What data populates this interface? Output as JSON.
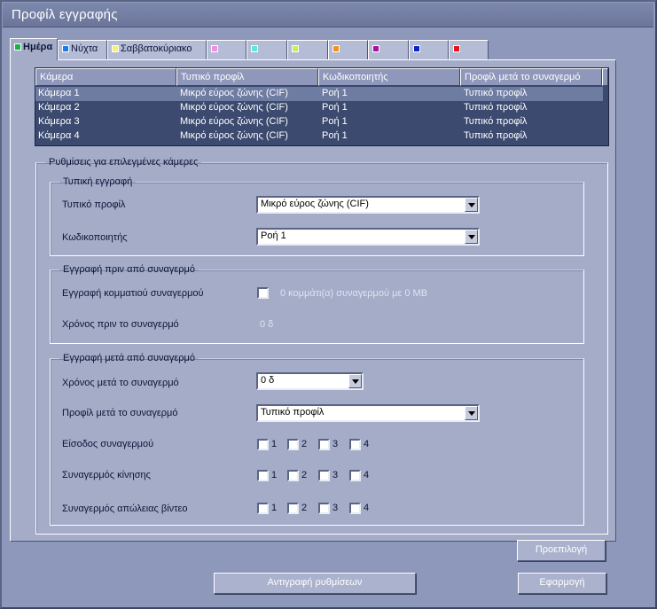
{
  "window": {
    "title": "Προφίλ εγγραφής"
  },
  "tabs": [
    {
      "label": "Ημέρα",
      "color": "#19b34a"
    },
    {
      "label": "Νύχτα",
      "color": "#1a7ce6"
    },
    {
      "label": "Σαββατοκύριακο",
      "color": "#f5f07a"
    },
    {
      "label": "",
      "color": "#f58ce0"
    },
    {
      "label": "",
      "color": "#5ae8e0"
    },
    {
      "label": "",
      "color": "#c8ec5a"
    },
    {
      "label": "",
      "color": "#f5921c"
    },
    {
      "label": "",
      "color": "#a6129c"
    },
    {
      "label": "",
      "color": "#0a22c8"
    },
    {
      "label": "",
      "color": "#e8101a"
    }
  ],
  "camera_table": {
    "headers": [
      "Κάμερα",
      "Τυπικό προφίλ",
      "Κωδικοποιητής",
      "Προφίλ μετά το συναγερμό"
    ],
    "rows": [
      [
        "Κάμερα 1",
        "Μικρό εύρος ζώνης (CIF)",
        "Ροή 1",
        "Τυπικό προφίλ"
      ],
      [
        "Κάμερα 2",
        "Μικρό εύρος ζώνης (CIF)",
        "Ροή 1",
        "Τυπικό προφίλ"
      ],
      [
        "Κάμερα 3",
        "Μικρό εύρος ζώνης (CIF)",
        "Ροή 1",
        "Τυπικό προφίλ"
      ],
      [
        "Κάμερα 4",
        "Μικρό εύρος ζώνης (CIF)",
        "Ροή 1",
        "Τυπικό προφίλ"
      ]
    ]
  },
  "settings": {
    "legend": "Ρυθμίσεις για επιλεγμένες κάμερες",
    "standard": {
      "legend": "Τυπική εγγραφή",
      "profile_label": "Τυπικό προφίλ",
      "profile_value": "Μικρό εύρος ζώνης (CIF)",
      "encoder_label": "Κωδικοποιητής",
      "encoder_value": "Ροή 1"
    },
    "pre_alarm": {
      "legend": "Εγγραφή πριν από συναγερμό",
      "segment_label": "Εγγραφή κομματιού συναγερμού",
      "segment_info": "0 κομμάτι(α) συναγερμού με 0 MB",
      "time_label": "Χρόνος πριν το συναγερμό",
      "time_value": "0 δ"
    },
    "post_alarm": {
      "legend": "Εγγραφή μετά από συναγερμό",
      "time_label": "Χρόνος μετά το συναγερμό",
      "time_value": "0 δ",
      "profile_label": "Προφίλ μετά το συναγερμό",
      "profile_value": "Τυπικό προφίλ",
      "alarm_input_label": "Είσοδος συναγερμού",
      "motion_label": "Συναγερμός κίνησης",
      "video_loss_label": "Συναγερμός απώλειας βίντεο",
      "channels": [
        "1",
        "2",
        "3",
        "4"
      ]
    }
  },
  "buttons": {
    "default": "Προεπιλογή",
    "copy": "Αντιγραφή ρυθμίσεων",
    "apply": "Εφαρμογή"
  }
}
